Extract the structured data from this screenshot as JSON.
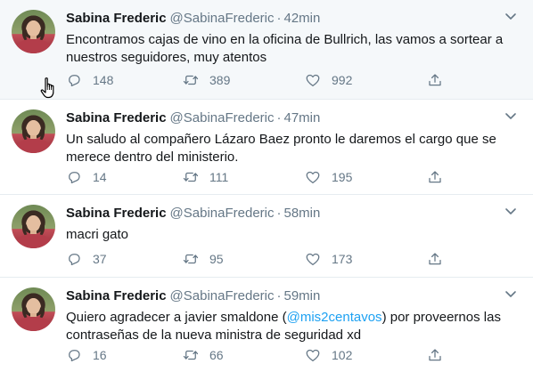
{
  "tweets": [
    {
      "name": "Sabina Frederic",
      "handle": "@SabinaFrederic",
      "dot": "·",
      "time": "42min",
      "text_parts": [
        "Encontramos cajas de vino en la oficina de Bullrich, las vamos a sortear a nuestros seguidores, muy atentos"
      ],
      "replies": "148",
      "retweets": "389",
      "likes": "992"
    },
    {
      "name": "Sabina Frederic",
      "handle": "@SabinaFrederic",
      "dot": "·",
      "time": "47min",
      "text_parts": [
        "Un saludo al compañero Lázaro Baez pronto le daremos el cargo que se merece dentro del ministerio."
      ],
      "replies": "14",
      "retweets": "111",
      "likes": "195"
    },
    {
      "name": "Sabina Frederic",
      "handle": "@SabinaFrederic",
      "dot": "·",
      "time": "58min",
      "text_parts": [
        "macri gato"
      ],
      "replies": "37",
      "retweets": "95",
      "likes": "173"
    },
    {
      "name": "Sabina Frederic",
      "handle": "@SabinaFrederic",
      "dot": "·",
      "time": "59min",
      "text_before": "Quiero agradecer a javier smaldone (",
      "mention": "@mis2centavos",
      "text_after": ") por proveernos las contraseñas de la nueva ministra de seguridad xd",
      "replies": "16",
      "retweets": "66",
      "likes": "102"
    }
  ],
  "icons": {
    "reply": "reply-icon",
    "retweet": "retweet-icon",
    "like": "heart-icon",
    "share": "share-icon",
    "caret": "chevron-down-icon",
    "cursor": "hand-pointer-icon"
  },
  "colors": {
    "text": "#14171a",
    "muted": "#657786",
    "link": "#1da1f2",
    "hover_bg": "#f5f8fa",
    "divider": "#e6ecf0"
  }
}
